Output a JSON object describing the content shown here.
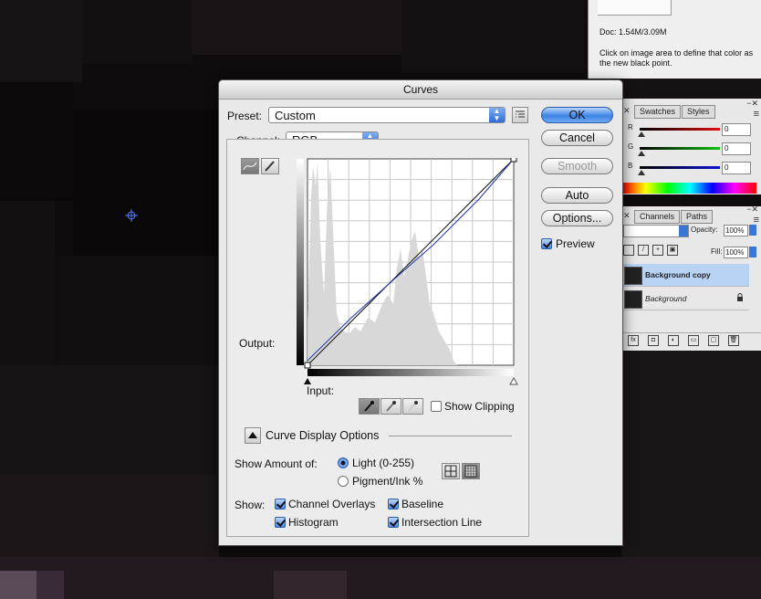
{
  "info_panel": {
    "doc_text": "Doc: 1.54M/3.09M",
    "hint_text": "Click on image area to define that color as the new black point."
  },
  "color_panel": {
    "tabs": [
      "Swatches",
      "Styles"
    ],
    "sliders": [
      {
        "label": "R",
        "value": "0",
        "color": "#e01010"
      },
      {
        "label": "G",
        "value": "0",
        "color": "#10c010"
      },
      {
        "label": "B",
        "value": "0",
        "color": "#1010d0"
      }
    ]
  },
  "layers_panel": {
    "tabs": [
      "Channels",
      "Paths"
    ],
    "opacity_label": "Opacity:",
    "opacity_value": "100%",
    "fill_label": "Fill:",
    "fill_value": "100%",
    "layers": [
      {
        "name": "Background copy",
        "selected": true
      },
      {
        "name": "Background",
        "selected": false,
        "locked": true
      }
    ]
  },
  "dialog": {
    "title": "Curves",
    "preset_label": "Preset:",
    "preset_value": "Custom",
    "channel_label": "Channel:",
    "channel_value": "RGB",
    "output_label": "Output:",
    "input_label": "Input:",
    "show_clipping_label": "Show Clipping",
    "buttons": {
      "ok": "OK",
      "cancel": "Cancel",
      "smooth": "Smooth",
      "auto": "Auto",
      "options": "Options..."
    },
    "preview_label": "Preview",
    "preview_checked": true,
    "curve_display_options_label": "Curve Display Options",
    "show_amount_label": "Show Amount of:",
    "light_label": "Light  (0-255)",
    "pigment_label": "Pigment/Ink %",
    "show_label": "Show:",
    "show_options": {
      "channel_overlays": {
        "label": "Channel Overlays",
        "checked": true
      },
      "baseline": {
        "label": "Baseline",
        "checked": true
      },
      "histogram": {
        "label": "Histogram",
        "checked": true
      },
      "intersection_line": {
        "label": "Intersection Line",
        "checked": true
      }
    },
    "curve": {
      "baseline_points": [
        [
          0,
          0
        ],
        [
          255,
          255
        ]
      ],
      "curve_points": [
        [
          0,
          0
        ],
        [
          255,
          255
        ]
      ],
      "curve_color": "#2233aa"
    },
    "accent_color": "#3d84e6"
  }
}
